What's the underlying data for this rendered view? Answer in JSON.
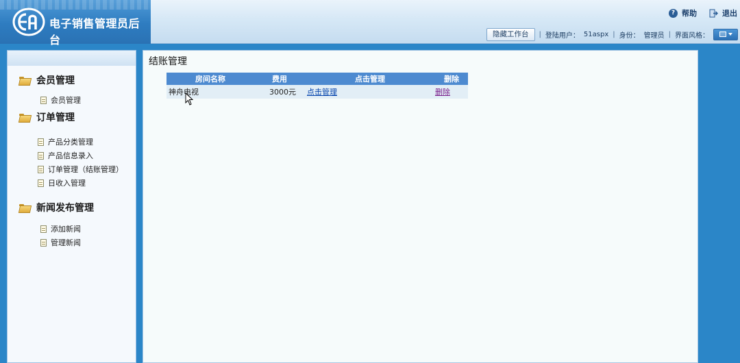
{
  "header": {
    "title": "电子销售管理员后台",
    "logo_icon": "ea-logo",
    "help_label": "帮助",
    "logout_label": "退出",
    "hide_workspace_label": "隐藏工作台",
    "user_label": "登陆用户：",
    "user_name": "51aspx",
    "role_label": "身份：",
    "role_value": "管理员",
    "theme_label": "界面风格："
  },
  "sidebar": {
    "groups": [
      {
        "title": "会员管理",
        "items": [
          "会员管理"
        ]
      },
      {
        "title": "订单管理",
        "items": [
          "产品分类管理",
          "产品信息录入",
          "订单管理（结账管理）",
          "日收入管理"
        ]
      },
      {
        "title": "新闻发布管理",
        "items": [
          "添加新闻",
          "管理新闻"
        ]
      }
    ]
  },
  "main": {
    "title": "结账管理",
    "table": {
      "headers": [
        "房间名称",
        "费用",
        "点击管理",
        "删除"
      ],
      "rows": [
        {
          "room": "神舟电视",
          "cost": "3000元",
          "manage": "点击管理",
          "delete": "删除"
        }
      ]
    }
  },
  "colors": {
    "background": "#2b86c8",
    "table_header": "#4d8ad0",
    "row": "#e2eef6"
  }
}
